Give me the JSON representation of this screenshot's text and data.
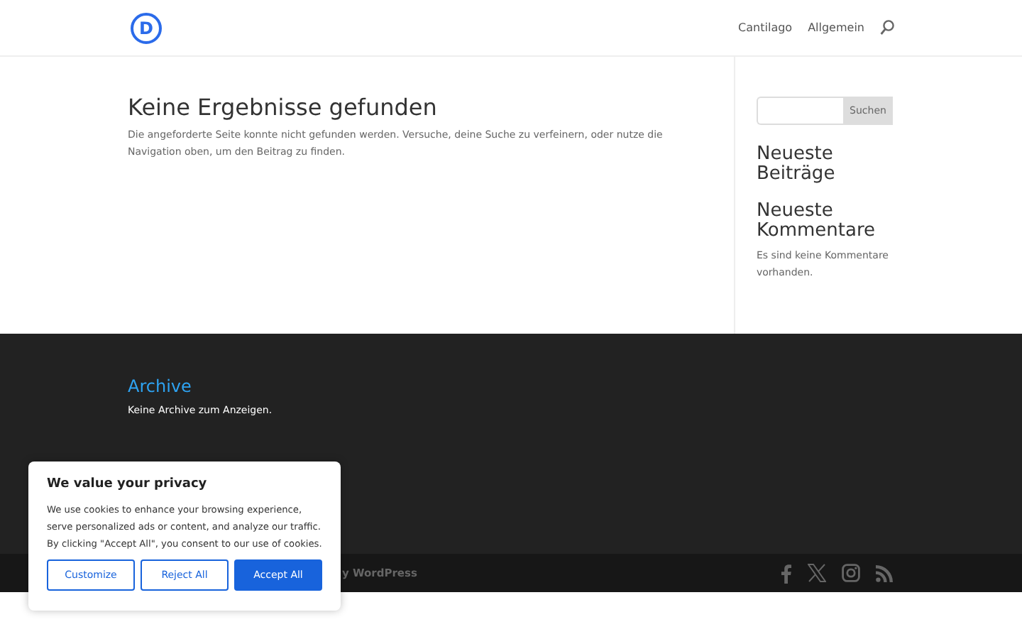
{
  "header": {
    "logo_letter": "D",
    "nav": [
      "Cantilago",
      "Allgemein"
    ]
  },
  "main": {
    "title": "Keine Ergebnisse gefunden",
    "message": "Die angeforderte Seite konnte nicht gefunden werden. Versuche, deine Suche zu verfeinern, oder nutze die Navigation oben, um den Beitrag zu finden."
  },
  "sidebar": {
    "search_button": "Suchen",
    "widgets": [
      {
        "title": "Neueste Beiträge"
      },
      {
        "title": "Neueste Kommentare",
        "text": "Es sind keine Kommentare vorhanden."
      }
    ]
  },
  "footer": {
    "widget_title": "Archive",
    "widget_text": "Keine Archive zum Anzeigen.",
    "credit": "y WordPress",
    "social": [
      {
        "kind": "facebook"
      },
      {
        "kind": "x"
      },
      {
        "kind": "instagram"
      },
      {
        "kind": "rss"
      }
    ]
  },
  "cookie_banner": {
    "title": "We value your privacy",
    "text": "We use cookies to enhance your browsing experience, serve personalized ads or content, and analyze our traffic. By clicking \"Accept All\", you consent to our use of cookies.",
    "buttons": [
      {
        "label": "Customize",
        "kind": "outline"
      },
      {
        "label": "Reject All",
        "kind": "outline"
      },
      {
        "label": "Accept All",
        "kind": "primary"
      }
    ]
  }
}
